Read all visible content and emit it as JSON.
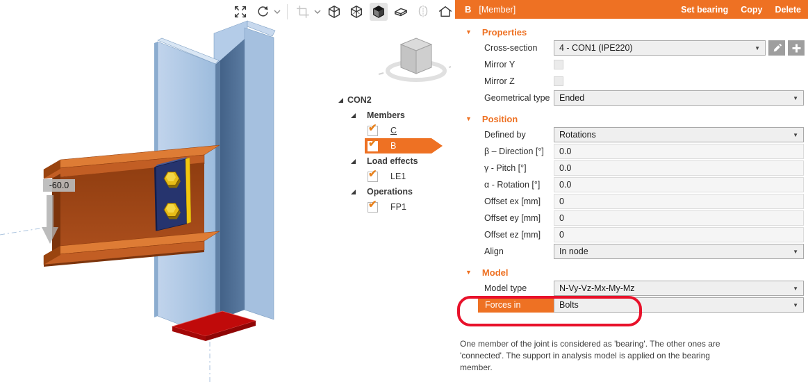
{
  "viewport": {
    "load_label": "-60.0",
    "toolbar_icons": [
      {
        "name": "zoom-extents",
        "state": "normal"
      },
      {
        "name": "rotate-view",
        "state": "normal",
        "chevron": true
      },
      {
        "divider": true
      },
      {
        "name": "section-crop",
        "state": "disabled",
        "chevron": true
      },
      {
        "name": "wireframe-cube",
        "state": "normal"
      },
      {
        "name": "hiddenline-cube",
        "state": "normal"
      },
      {
        "name": "solid-cube",
        "state": "selected"
      },
      {
        "name": "section-view",
        "state": "normal"
      },
      {
        "name": "mirror-view",
        "state": "disabled"
      },
      {
        "name": "home-view",
        "state": "normal"
      }
    ]
  },
  "tree": {
    "rows": [
      {
        "type": "root",
        "label": "CON2"
      },
      {
        "type": "group",
        "label": "Members"
      },
      {
        "type": "item",
        "label": "C",
        "checked": true,
        "underline": true
      },
      {
        "type": "item",
        "label": "B",
        "checked": true,
        "selected": true
      },
      {
        "type": "group",
        "label": "Load effects"
      },
      {
        "type": "item",
        "label": "LE1",
        "checked": true
      },
      {
        "type": "group",
        "label": "Operations"
      },
      {
        "type": "item",
        "label": "FP1",
        "checked": true
      }
    ]
  },
  "panel": {
    "header": {
      "title": "B",
      "subtitle": "[Member]",
      "actions": [
        {
          "label": "Set bearing"
        },
        {
          "label": "Copy"
        },
        {
          "label": "Delete"
        }
      ]
    },
    "sections": [
      {
        "title": "Properties",
        "rows": [
          {
            "label": "Cross-section",
            "type": "dropdown",
            "value": "4 - CON1 (IPE220)",
            "narrow": true,
            "extras": [
              "edit",
              "add"
            ]
          },
          {
            "label": "Mirror Y",
            "type": "checkbox",
            "checked": false
          },
          {
            "label": "Mirror Z",
            "type": "checkbox",
            "checked": false
          },
          {
            "label": "Geometrical type",
            "type": "dropdown",
            "value": "Ended"
          }
        ]
      },
      {
        "title": "Position",
        "rows": [
          {
            "label": "Defined by",
            "type": "dropdown",
            "value": "Rotations"
          },
          {
            "label": "β – Direction [°]",
            "type": "input",
            "value": "0.0"
          },
          {
            "label": "γ - Pitch [°]",
            "type": "input",
            "value": "0.0"
          },
          {
            "label": "α - Rotation [°]",
            "type": "input",
            "value": "0.0"
          },
          {
            "label": "Offset ex [mm]",
            "type": "input",
            "value": "0"
          },
          {
            "label": "Offset ey [mm]",
            "type": "input",
            "value": "0"
          },
          {
            "label": "Offset ez [mm]",
            "type": "input",
            "value": "0"
          },
          {
            "label": "Align",
            "type": "dropdown",
            "value": "In node"
          }
        ]
      },
      {
        "title": "Model",
        "rows": [
          {
            "label": "Model type",
            "type": "dropdown",
            "value": "N-Vy-Vz-Mx-My-Mz"
          },
          {
            "label": "Forces in",
            "type": "dropdown",
            "value": "Bolts",
            "highlighted": true
          }
        ]
      }
    ],
    "description": "One member of the joint is considered as 'bearing'. The other ones are 'connected'. The support in analysis model is applied on the bearing member."
  },
  "colors": {
    "accent_orange": "#EE7123",
    "annotation_red": "#E8112A",
    "beam_orange": "#C25E24",
    "column_blue": "#A9C6E4",
    "fin_plate_navy": "#26346E",
    "bolt_yellow": "#E6BC17",
    "base_plate_red": "#C00A0A"
  }
}
